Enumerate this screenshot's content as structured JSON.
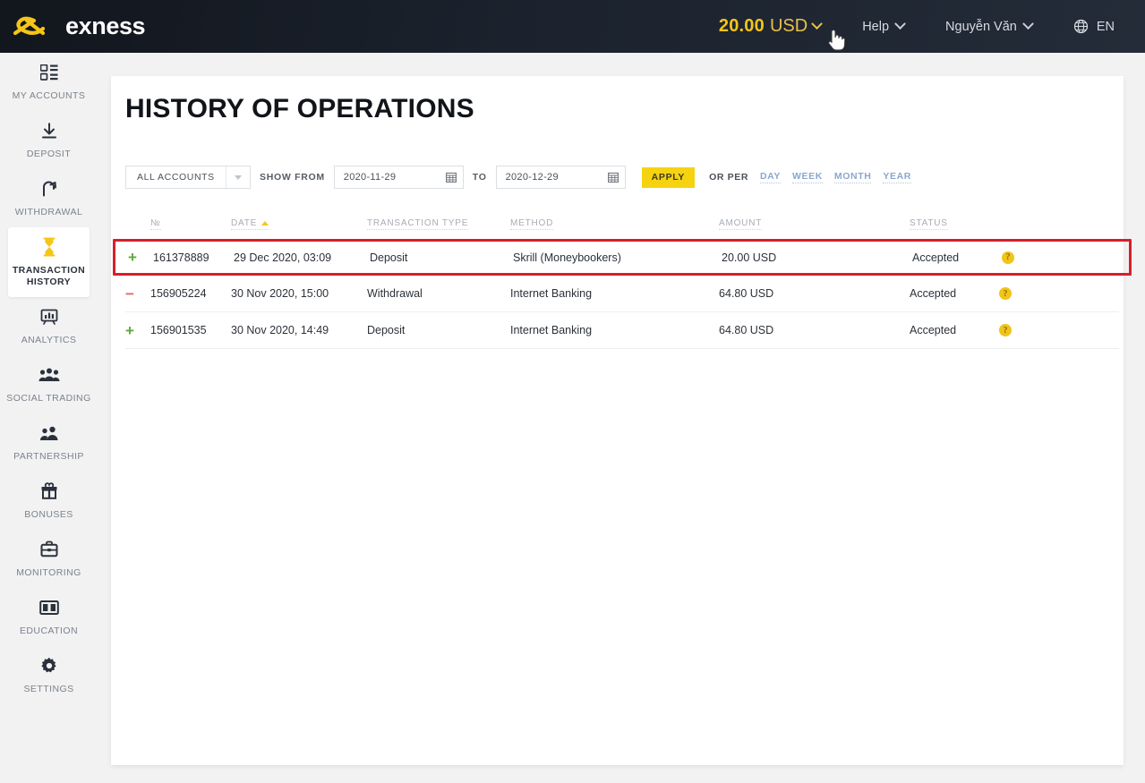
{
  "brand": {
    "name": "exness",
    "logo_icon": "exness-logo-icon"
  },
  "header": {
    "balance": {
      "amount": "20.00",
      "currency": "USD",
      "chevron_icon": "chevron-down-icon"
    },
    "help": {
      "label": "Help",
      "chevron_icon": "chevron-down-icon"
    },
    "account": {
      "label": "Nguyễn Văn",
      "chevron_icon": "chevron-down-icon"
    },
    "language": {
      "label": "EN",
      "globe_icon": "globe-icon"
    },
    "cursor_icon": "pointing-hand-cursor"
  },
  "sidebar": {
    "items": [
      {
        "label": "MY ACCOUNTS",
        "icon": "dashboard-grid-icon",
        "active": false
      },
      {
        "label": "DEPOSIT",
        "icon": "download-arrow-icon",
        "active": false
      },
      {
        "label": "WITHDRAWAL",
        "icon": "upload-arrow-icon",
        "active": false
      },
      {
        "label": "TRANSACTION HISTORY",
        "icon": "hourglass-icon",
        "active": true
      },
      {
        "label": "ANALYTICS",
        "icon": "chart-board-icon",
        "active": false
      },
      {
        "label": "SOCIAL TRADING",
        "icon": "people-group-icon",
        "active": false
      },
      {
        "label": "PARTNERSHIP",
        "icon": "two-people-icon",
        "active": false
      },
      {
        "label": "BONUSES",
        "icon": "gift-icon",
        "active": false
      },
      {
        "label": "MONITORING",
        "icon": "briefcase-icon",
        "active": false
      },
      {
        "label": "EDUCATION",
        "icon": "open-book-icon",
        "active": false
      },
      {
        "label": "SETTINGS",
        "icon": "gear-icon",
        "active": false
      }
    ]
  },
  "main": {
    "title": "HISTORY OF OPERATIONS",
    "filters": {
      "account_select": {
        "value": "ALL ACCOUNTS",
        "caret_icon": "caret-down-icon"
      },
      "show_from_label": "SHOW FROM",
      "date_from": {
        "value": "2020-11-29",
        "calendar_icon": "calendar-icon"
      },
      "to_label": "TO",
      "date_to": {
        "value": "2020-12-29",
        "calendar_icon": "calendar-icon"
      },
      "apply_label": "APPLY",
      "or_per_label": "OR PER",
      "periods": [
        "DAY",
        "WEEK",
        "MONTH",
        "YEAR"
      ]
    },
    "table": {
      "columns": [
        "№",
        "DATE",
        "TRANSACTION TYPE",
        "METHOD",
        "AMOUNT",
        "STATUS"
      ],
      "sort": {
        "column": "DATE",
        "direction": "asc",
        "icon": "sort-asc-icon"
      },
      "rows": [
        {
          "sign": "+",
          "number": "161378889",
          "date": "29 Dec 2020, 03:09",
          "type": "Deposit",
          "method": "Skrill (Moneybookers)",
          "amount": "20.00 USD",
          "status": "Accepted",
          "info_icon": "question-mark-icon",
          "highlighted": true
        },
        {
          "sign": "−",
          "number": "156905224",
          "date": "30 Nov 2020, 15:00",
          "type": "Withdrawal",
          "method": "Internet Banking",
          "amount": "64.80 USD",
          "status": "Accepted",
          "info_icon": "question-mark-icon",
          "highlighted": false
        },
        {
          "sign": "+",
          "number": "156901535",
          "date": "30 Nov 2020, 14:49",
          "type": "Deposit",
          "method": "Internet Banking",
          "amount": "64.80 USD",
          "status": "Accepted",
          "info_icon": "question-mark-icon",
          "highlighted": false
        }
      ]
    }
  },
  "colors": {
    "brand_yellow": "#f5c518",
    "apply_yellow": "#f5d311",
    "header_dark": "#1b222d",
    "highlight_red": "#d6202a",
    "plus_green": "#62a83a",
    "minus_red": "#e06a5a",
    "period_blue": "#89a8cf"
  }
}
